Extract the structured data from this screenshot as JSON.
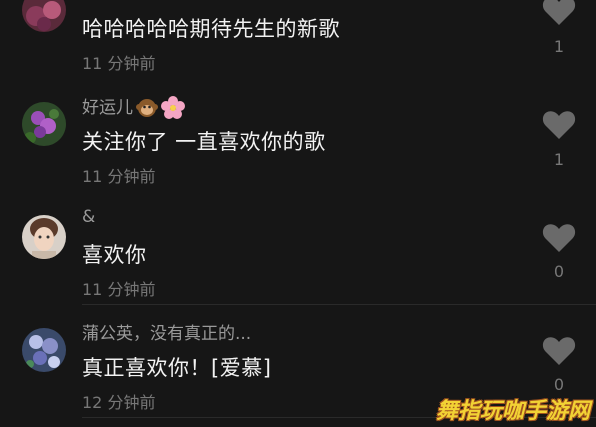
{
  "comments": [
    {
      "username": "",
      "text": "哈哈哈哈哈期待先生的新歌",
      "time": "11 分钟前",
      "likes": "1"
    },
    {
      "username": "好运儿",
      "text": "关注你了 一直喜欢你的歌",
      "time": "11 分钟前",
      "likes": "1"
    },
    {
      "username": "&",
      "text": "喜欢你",
      "time": "11 分钟前",
      "likes": "0"
    },
    {
      "username": "蒲公英，没有真正的...",
      "text": "真正喜欢你！[爱慕]",
      "time": "12 分钟前",
      "likes": "0"
    }
  ],
  "watermark": "舞指玩咖手游网",
  "colors": {
    "background": "#161616",
    "text": "#f2f2f2",
    "secondary": "#777777",
    "like_icon": "#6a6a6a"
  }
}
